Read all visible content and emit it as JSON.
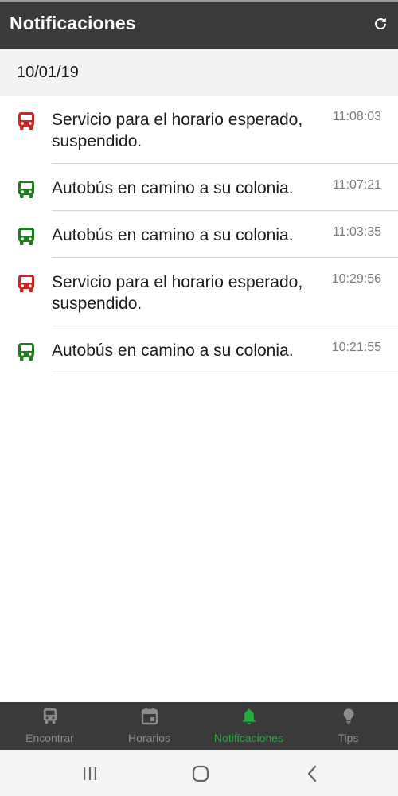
{
  "header": {
    "title": "Notificaciones",
    "refresh_icon": "refresh-icon"
  },
  "date": "10/01/19",
  "notifications": [
    {
      "status": "alert",
      "icon": "bus-icon",
      "color": "#d62222",
      "text": "Servicio para el horario esperado, suspendido.",
      "time": "11:08:03"
    },
    {
      "status": "ok",
      "icon": "bus-icon",
      "color": "#1e7d1e",
      "text": "Autobús en camino a su colonia.",
      "time": "11:07:21"
    },
    {
      "status": "ok",
      "icon": "bus-icon",
      "color": "#1e7d1e",
      "text": "Autobús en camino a su colonia.",
      "time": "11:03:35"
    },
    {
      "status": "alert",
      "icon": "bus-icon",
      "color": "#d62222",
      "text": "Servicio para el horario esperado, suspendido.",
      "time": "10:29:56"
    },
    {
      "status": "ok",
      "icon": "bus-icon",
      "color": "#1e7d1e",
      "text": "Autobús en camino a su colonia.",
      "time": "10:21:55"
    }
  ],
  "bottom_nav": {
    "items": [
      {
        "label": "Encontrar",
        "icon": "bus-icon"
      },
      {
        "label": "Horarios",
        "icon": "calendar-icon"
      },
      {
        "label": "Notificaciones",
        "icon": "bell-icon"
      },
      {
        "label": "Tips",
        "icon": "lightbulb-icon"
      }
    ],
    "active": "Notificaciones",
    "active_color": "#1fae3e",
    "inactive_color": "#8c8c8c"
  },
  "system_nav": {
    "recents_icon": "recents-icon",
    "home_icon": "home-icon",
    "back_icon": "back-icon"
  }
}
